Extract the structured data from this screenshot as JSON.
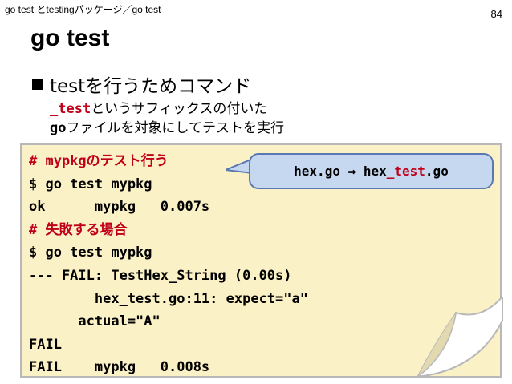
{
  "header": "go test とtestingパッケージ／go test",
  "page_number": "84",
  "title": "go test",
  "bullet": "testを行うためコマンド",
  "sub1": {
    "prefix": "_test",
    "rest": "というサフィックスの付いた"
  },
  "sub2": {
    "prefix": "go",
    "rest": "ファイルを対象にしてテストを実行"
  },
  "code": {
    "comment1": "# mypkgのテスト行う",
    "line2": "$ go test mypkg",
    "line3": "ok      mypkg   0.007s",
    "comment2": "# 失敗する場合",
    "line5": "$ go test mypkg",
    "line6": "--- FAIL: TestHex_String (0.00s)",
    "line7": "        hex_test.go:11: expect=\"a\"",
    "line8": "      actual=\"A\"",
    "line9": "FAIL",
    "line10": "FAIL    mypkg   0.008s"
  },
  "callout": {
    "a": "hex.go ⇒ hex",
    "b": "_test",
    "c": ".go"
  },
  "colors": {
    "accent_red": "#c0001a",
    "note_bg": "#fbf1c6",
    "callout_bg": "#c6d7f0",
    "callout_border": "#5b78b2"
  }
}
